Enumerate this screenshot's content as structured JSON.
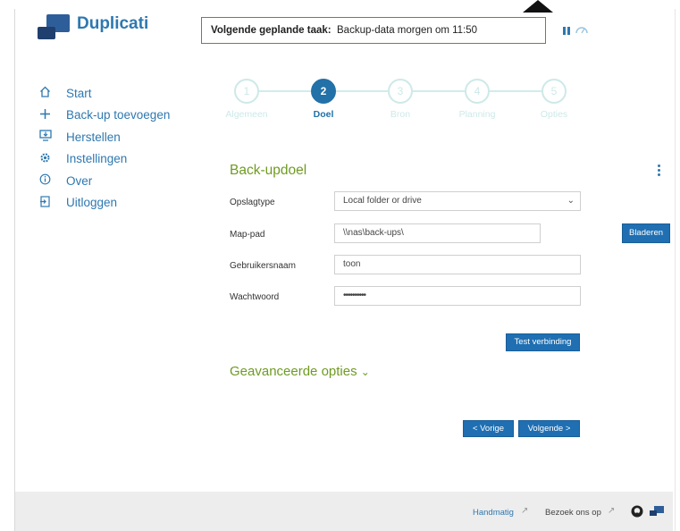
{
  "app": {
    "name": "Duplicati"
  },
  "header": {
    "schedule_label": "Volgende geplande taak:",
    "schedule_value": "Backup-data morgen om 11:50",
    "pause_icon": "pause-icon",
    "throttle_icon": "speed-icon"
  },
  "sidebar": {
    "items": [
      {
        "label": "Start",
        "icon": "home-icon"
      },
      {
        "label": "Back-up toevoegen",
        "icon": "plus-icon"
      },
      {
        "label": "Herstellen",
        "icon": "restore-icon"
      },
      {
        "label": "Instellingen",
        "icon": "gear-icon"
      },
      {
        "label": "Over",
        "icon": "info-icon"
      },
      {
        "label": "Uitloggen",
        "icon": "logout-icon"
      }
    ]
  },
  "wizard": {
    "steps": [
      {
        "number": "1",
        "label": "Algemeen"
      },
      {
        "number": "2",
        "label": "Doel",
        "active": true
      },
      {
        "number": "3",
        "label": "Bron"
      },
      {
        "number": "4",
        "label": "Planning"
      },
      {
        "number": "5",
        "label": "Opties"
      }
    ]
  },
  "form": {
    "title": "Back-updoel",
    "storage_type_label": "Opslagtype",
    "storage_type_value": "Local folder or drive",
    "path_label": "Map-pad",
    "path_value": "\\\\nas\\back-ups\\",
    "browse_label": "Bladeren",
    "username_label": "Gebruikersnaam",
    "username_value": "toon",
    "password_label": "Wachtwoord",
    "password_value": "••••••••••",
    "test_label": "Test verbinding",
    "advanced_label": "Geavanceerde opties",
    "prev_label": "< Vorige",
    "next_label": "Volgende >"
  },
  "footer": {
    "manual_label": "Handmatig",
    "visit_label": "Bezoek ons op"
  },
  "colors": {
    "accent": "#2e78b0",
    "button": "#1f6fb2",
    "section": "#6f9b22",
    "step_inactive": "#cde9e8"
  }
}
